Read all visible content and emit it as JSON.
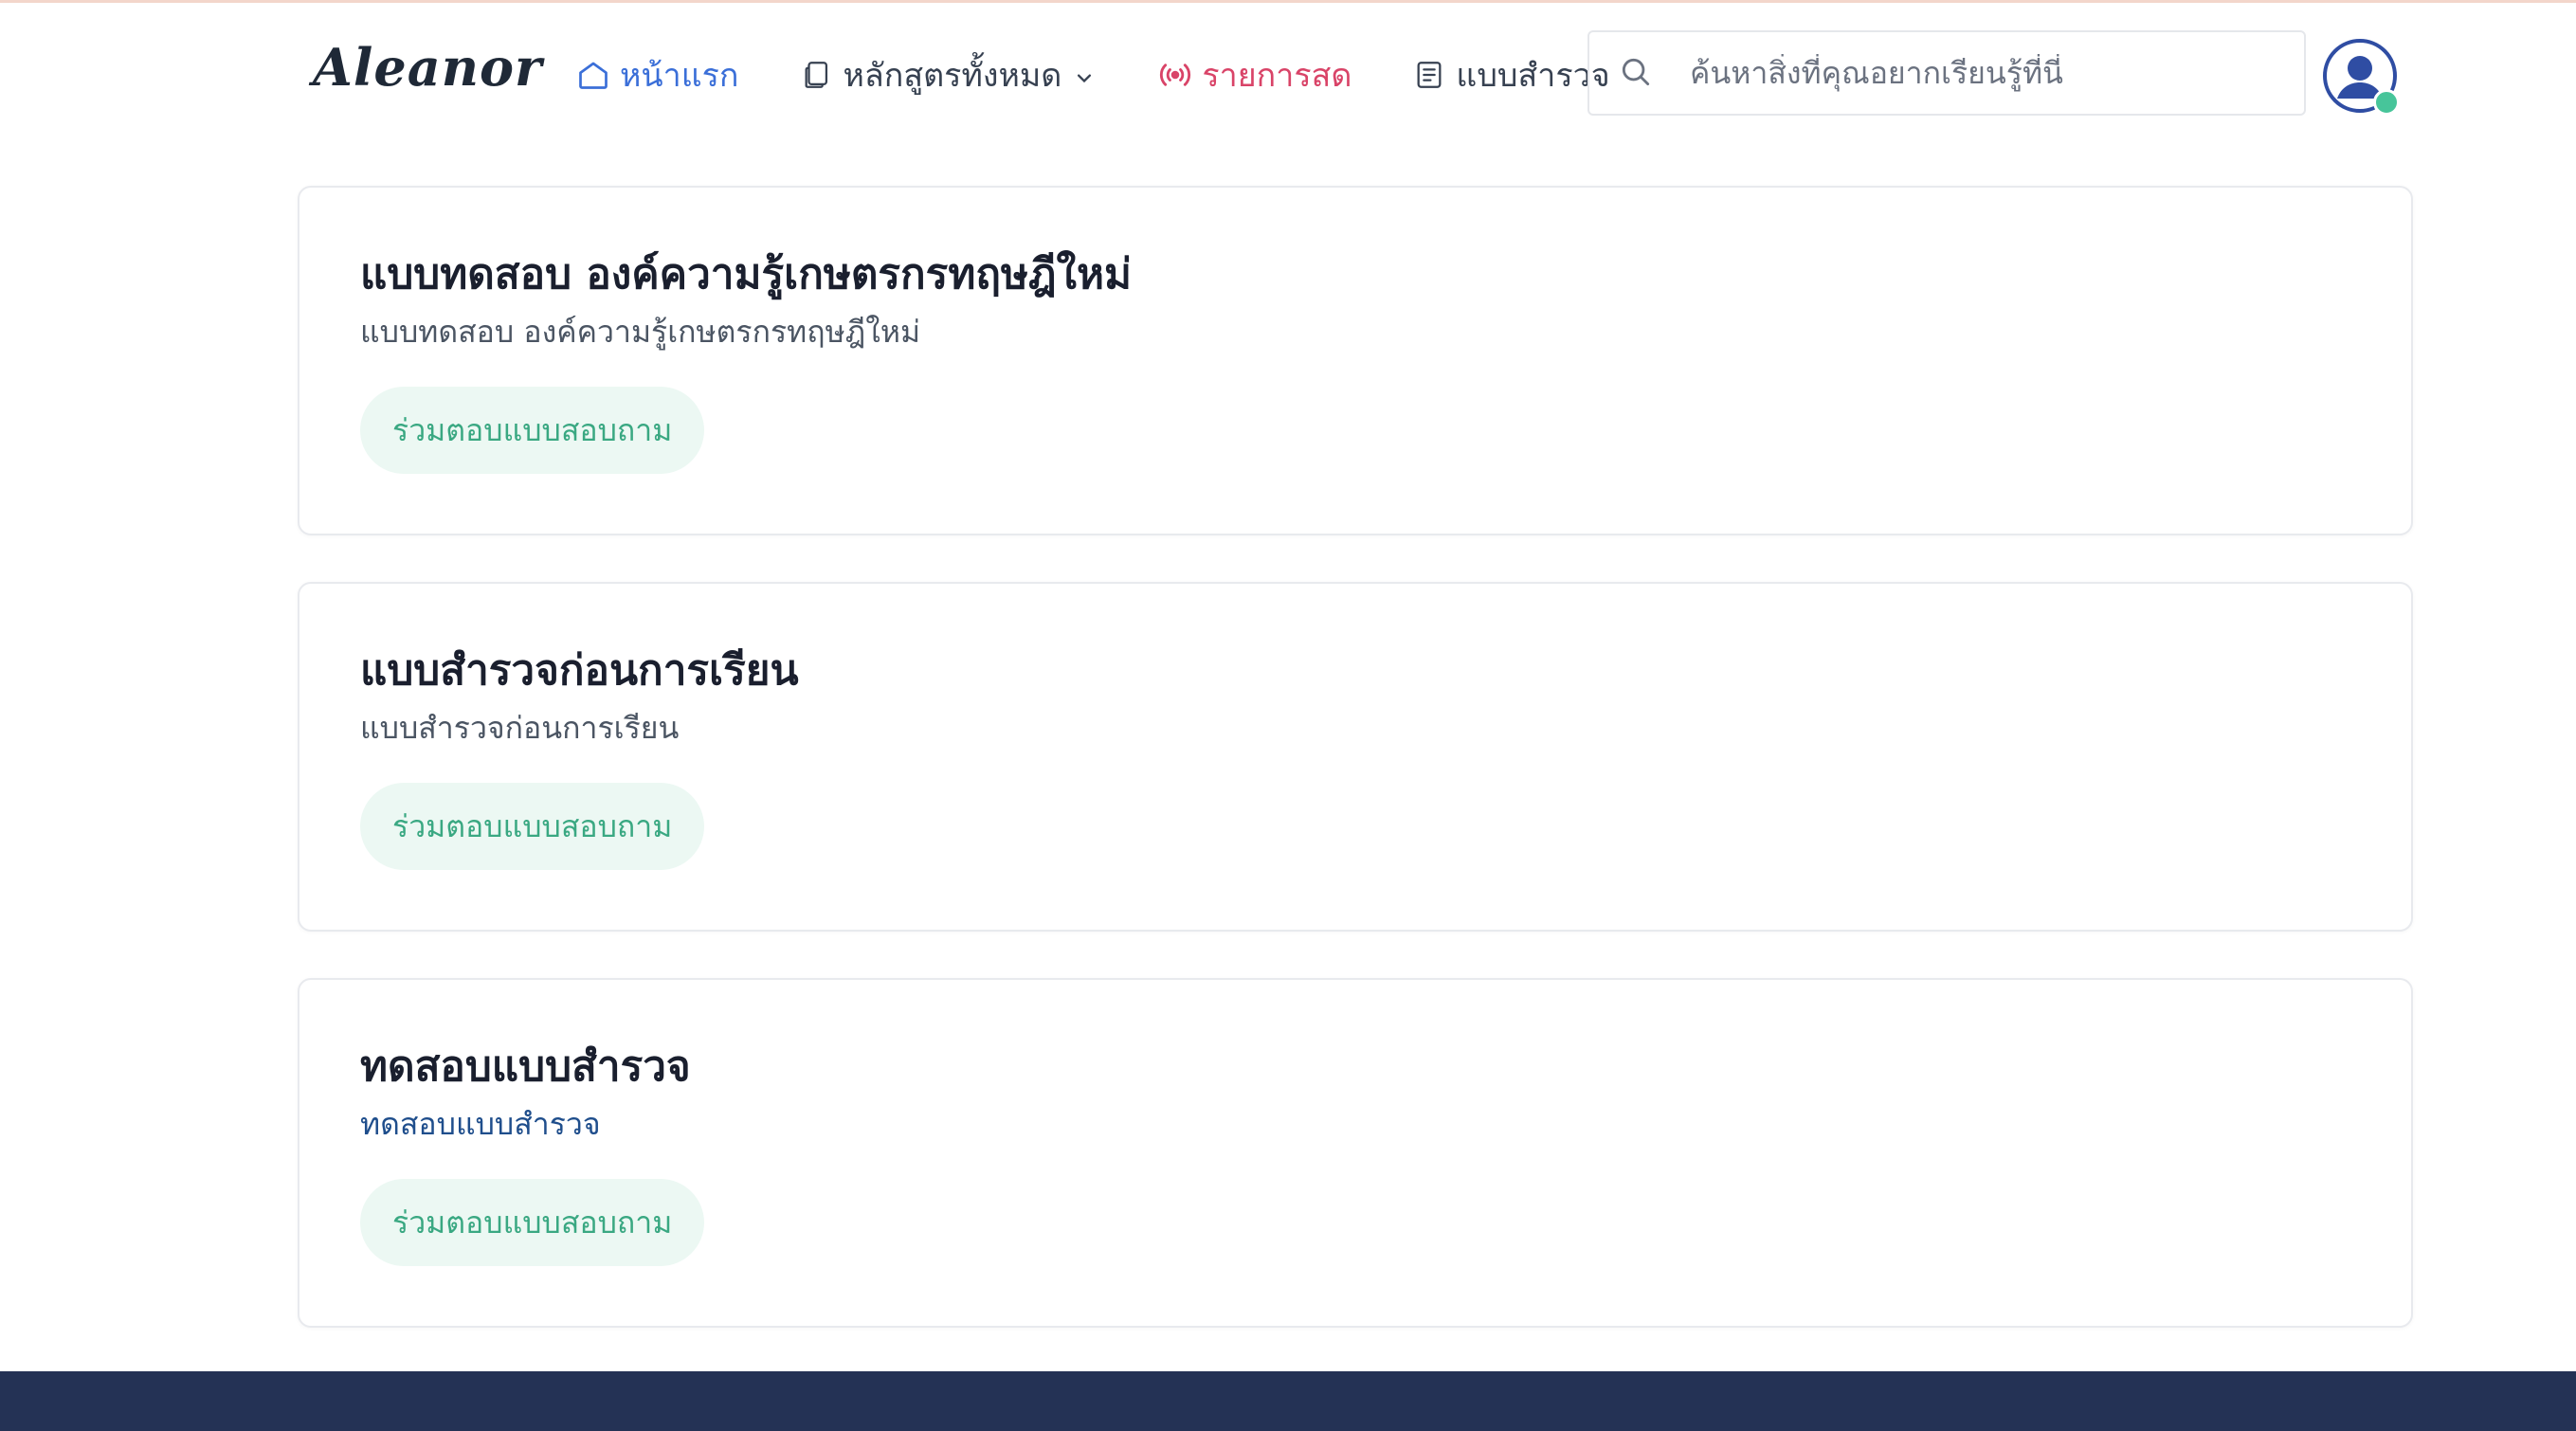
{
  "header": {
    "logo": "Aleanor",
    "nav": {
      "home": "หน้าแรก",
      "courses": "หลักสูตรทั้งหมด",
      "live": "รายการสด",
      "survey": "แบบสำรวจ"
    },
    "search": {
      "placeholder": "ค้นหาสิ่งที่คุณอยากเรียนรู้ที่นี่"
    }
  },
  "cards": [
    {
      "title": "แบบทดสอบ องค์ความรู้เกษตรกรทฤษฎีใหม่",
      "subtitle": "แบบทดสอบ องค์ความรู้เกษตรกรทฤษฎีใหม่",
      "button": "ร่วมตอบแบบสอบถาม"
    },
    {
      "title": "แบบสำรวจก่อนการเรียน",
      "subtitle": "แบบสำรวจก่อนการเรียน",
      "button": "ร่วมตอบแบบสอบถาม"
    },
    {
      "title": "ทดสอบแบบสำรวจ",
      "subtitle": "ทดสอบแบบสำรวจ",
      "button": "ร่วมตอบแบบสอบถาม"
    }
  ],
  "colors": {
    "home_active": "#3b6fd8",
    "live": "#d94468",
    "button_text": "#3aa882",
    "button_bg": "#ecf8f3",
    "footer": "#243255",
    "online_dot": "#47c59a"
  },
  "icons": {
    "home": "home-icon",
    "courses": "copy-icon",
    "live": "broadcast-icon",
    "survey": "document-icon",
    "search": "search-icon",
    "avatar": "user-avatar-icon"
  }
}
